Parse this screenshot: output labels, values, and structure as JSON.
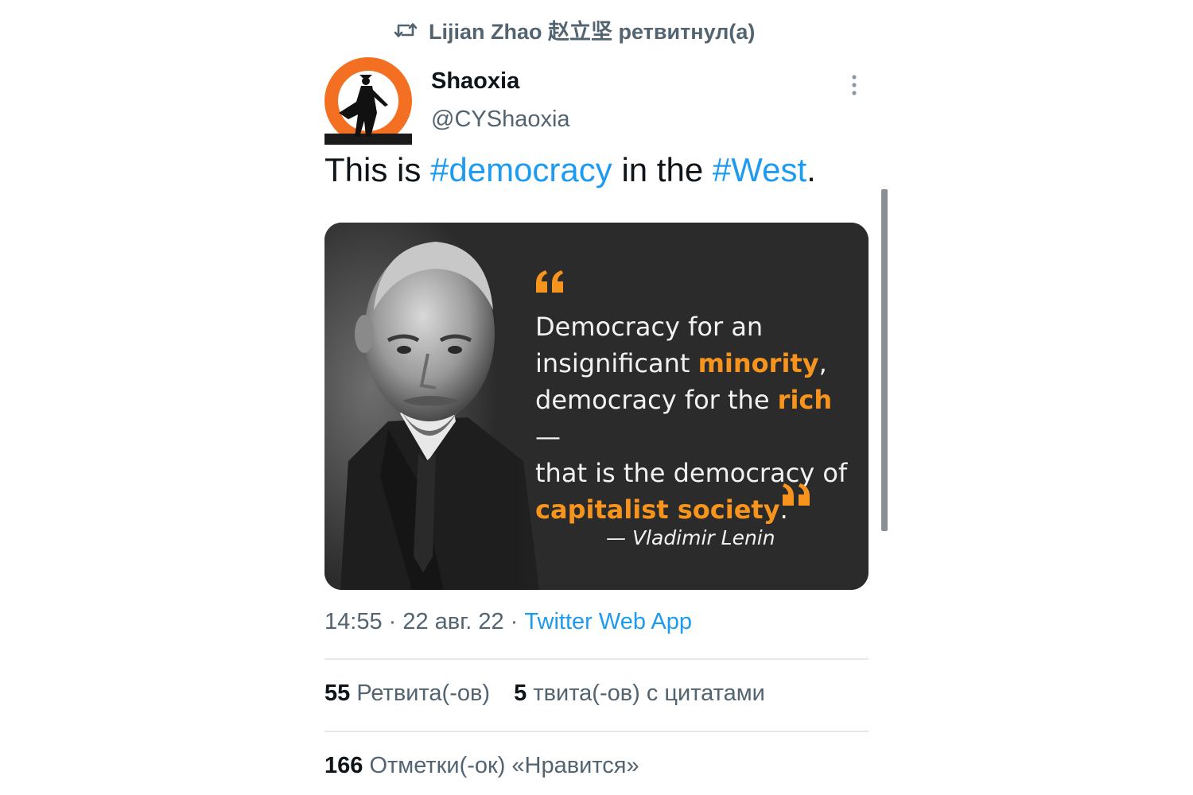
{
  "retweet": {
    "icon": "retweet-icon",
    "text": "Lijian Zhao 赵立坚 ретвитнул(а)"
  },
  "author": {
    "name": "Shaoxia",
    "handle": "@CYShaoxia",
    "avatar_icon": "silhouette-avatar",
    "avatar_color": "#f36f21"
  },
  "tweet": {
    "part1": "This is ",
    "hashtag1": "#democracy",
    "part2": " in the ",
    "hashtag2": "#West",
    "part3": "."
  },
  "media": {
    "quote_line1": "Democracy for an",
    "quote_line2a": "insignificant ",
    "quote_line2b": "minority",
    "quote_line2c": ",",
    "quote_line3a": "democracy for the ",
    "quote_line3b": "rich",
    "quote_line3c": " —",
    "quote_line4": "that is the democracy of",
    "quote_line5a": "capitalist society",
    "quote_line5b": ".",
    "attribution": "— Vladimir Lenin",
    "accent_color": "#f7941d"
  },
  "meta": {
    "time": "14:55",
    "sep1": " · ",
    "date": "22 авг. 22",
    "sep2": " · ",
    "source": "Twitter Web App"
  },
  "stats": {
    "retweets_count": "55",
    "retweets_label": "Ретвита(-ов)",
    "quotes_count": "5",
    "quotes_label": "твита(-ов) с цитатами",
    "likes_count": "166",
    "likes_label": "Отметки(-ок) «Нравится»"
  },
  "colors": {
    "link": "#1d9bf0",
    "secondary_text": "#536471",
    "primary_text": "#0f1419"
  }
}
